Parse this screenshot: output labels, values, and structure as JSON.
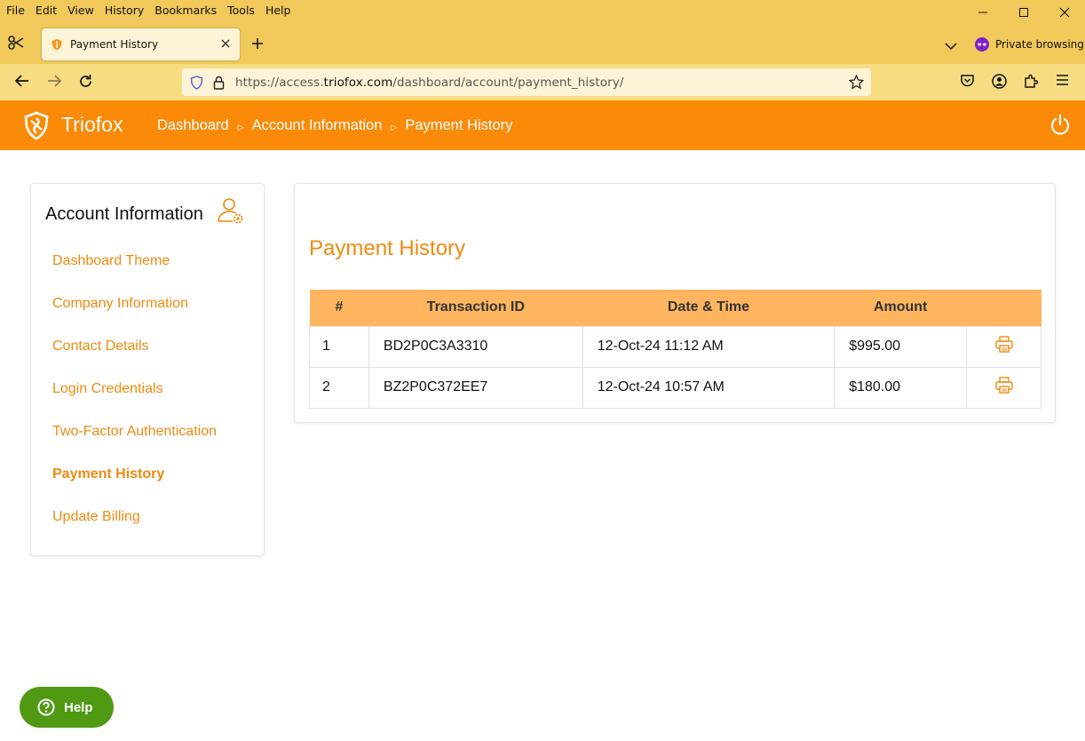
{
  "browser": {
    "menu": [
      "File",
      "Edit",
      "View",
      "History",
      "Bookmarks",
      "Tools",
      "Help"
    ],
    "tab_title": "Payment History",
    "private_label": "Private browsing",
    "url_prefix": "https://access.",
    "url_host": "triofox.com",
    "url_path": "/dashboard/account/payment_history/"
  },
  "app": {
    "brand": "Triofox",
    "breadcrumbs": [
      "Dashboard",
      "Account Information",
      "Payment History"
    ],
    "accent_color": "#fb8a08"
  },
  "sidebar": {
    "title": "Account Information",
    "items": [
      {
        "label": "Dashboard Theme"
      },
      {
        "label": "Company Information"
      },
      {
        "label": "Contact Details"
      },
      {
        "label": "Login Credentials"
      },
      {
        "label": "Two-Factor Authentication"
      },
      {
        "label": "Payment History",
        "active": true
      },
      {
        "label": "Update Billing"
      }
    ]
  },
  "main": {
    "title": "Payment History",
    "columns": [
      "#",
      "Transaction ID",
      "Date & Time",
      "Amount",
      ""
    ],
    "rows": [
      {
        "num": "1",
        "transaction_id": "BD2P0C3A3310",
        "datetime": "12-Oct-24 11:12 AM",
        "amount": "$995.00",
        "action_icon": "printer-icon"
      },
      {
        "num": "2",
        "transaction_id": "BZ2P0C372EE7",
        "datetime": "12-Oct-24 10:57 AM",
        "amount": "$180.00",
        "action_icon": "printer-icon"
      }
    ]
  },
  "help": {
    "label": "Help"
  }
}
